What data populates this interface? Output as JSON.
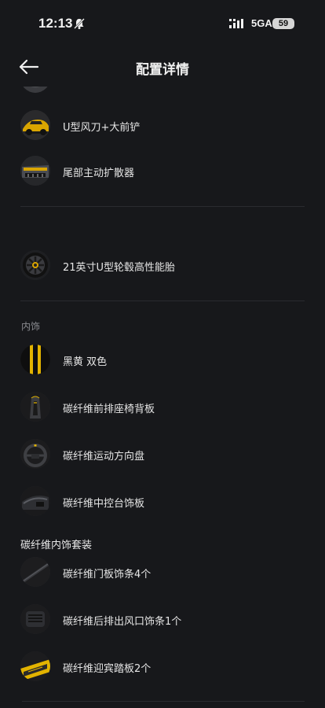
{
  "status": {
    "time": "12:13",
    "network": "5GA",
    "battery": "59"
  },
  "nav": {
    "title": "配置详情"
  },
  "exterior_items": [
    {
      "label": "U型风刀+大前铲",
      "icon": "front-splitter-icon"
    },
    {
      "label": "尾部主动扩散器",
      "icon": "rear-diffuser-icon"
    }
  ],
  "wheel_item": {
    "label": "21英寸U型轮毂高性能胎",
    "icon": "wheel-icon"
  },
  "interior": {
    "section_label": "内饰",
    "items": [
      {
        "label": "黑黄 双色",
        "icon": "color-swatch-icon",
        "colors": [
          "#111111",
          "#e2b300"
        ]
      },
      {
        "label": "碳纤维前排座椅背板",
        "icon": "seat-back-icon"
      },
      {
        "label": "碳纤维运动方向盘",
        "icon": "steering-wheel-icon"
      },
      {
        "label": "碳纤维中控台饰板",
        "icon": "console-trim-icon"
      }
    ]
  },
  "carbon_package": {
    "title": "碳纤维内饰套装",
    "items": [
      {
        "label": "碳纤维门板饰条4个",
        "icon": "door-trim-icon"
      },
      {
        "label": "碳纤维后排出风口饰条1个",
        "icon": "rear-vent-icon"
      },
      {
        "label": "碳纤维迎宾踏板2个",
        "icon": "sill-plate-icon"
      }
    ]
  },
  "theme": {
    "background": "#17181b",
    "accent": "#e2b300"
  }
}
